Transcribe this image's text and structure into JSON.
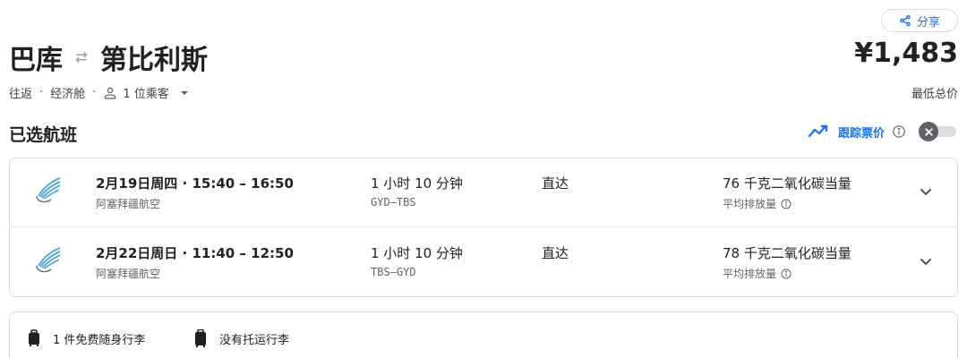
{
  "header": {
    "origin": "巴库",
    "destination": "第比利斯",
    "share_label": "分享",
    "price": "¥1,483",
    "price_note": "最低总价"
  },
  "trip": {
    "type": "往返",
    "cabin": "经济舱",
    "passengers": "1 位乘客",
    "separator": "·"
  },
  "selected": {
    "title": "已选航班",
    "track_label": "跟踪票价"
  },
  "flights": [
    {
      "time": "2月19日周四 · 15:40 – 16:50",
      "airline": "阿塞拜疆航空",
      "duration": "1 小时 10 分钟",
      "codes": "GYD–TBS",
      "stops": "直达",
      "emissions": "76 千克二氧化碳当量",
      "emissions_note": "平均排放量"
    },
    {
      "time": "2月22日周日 · 11:40 – 12:50",
      "airline": "阿塞拜疆航空",
      "duration": "1 小时 10 分钟",
      "codes": "TBS–GYD",
      "stops": "直达",
      "emissions": "78 千克二氧化碳当量",
      "emissions_note": "平均排放量"
    }
  ],
  "baggage": {
    "carry_on": "1 件免费随身行李",
    "checked": "没有托运行李"
  },
  "colors": {
    "accent": "#1a73e8",
    "text": "#202124",
    "muted": "#5f6368",
    "border": "#dadce0",
    "logo": "#4aa3d8"
  }
}
